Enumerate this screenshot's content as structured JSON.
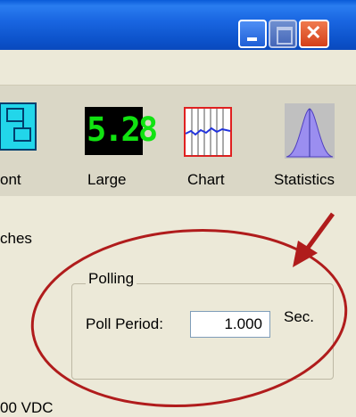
{
  "window": {
    "controls": {
      "minimize": "minimize-icon",
      "maximize": "maximize-icon",
      "close": "close-icon"
    }
  },
  "toolbar": {
    "items": [
      {
        "label": "ont",
        "icon": "font-icon"
      },
      {
        "label": "Large",
        "icon": "large-display-icon",
        "display_value": "5.28"
      },
      {
        "label": "Chart",
        "icon": "chart-icon"
      },
      {
        "label": "Statistics",
        "icon": "statistics-icon"
      }
    ]
  },
  "content": {
    "partial_label_top": "ches",
    "partial_label_bottom": "00 VDC"
  },
  "polling": {
    "legend": "Polling",
    "poll_period_label": "Poll Period:",
    "poll_period_value": "1.000",
    "unit": "Sec."
  },
  "annotation": {
    "color": "#b01c1c"
  }
}
